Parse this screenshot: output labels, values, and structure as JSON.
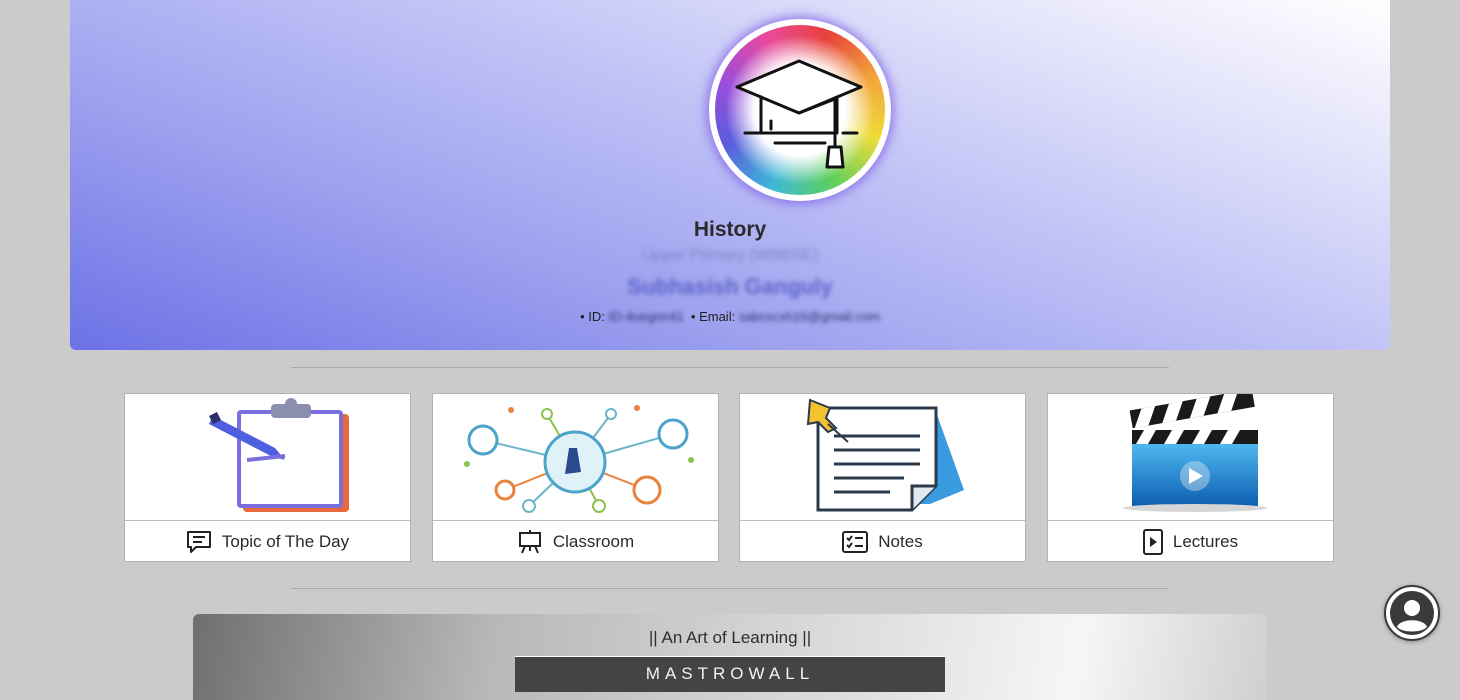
{
  "profile": {
    "course_title": "History",
    "course_subtitle": "Upper Primary (WBBSE)",
    "teacher_name": "Subhasish Ganguly",
    "id_label": "• ID:",
    "id_value": "ID-4uegnn41",
    "email_label": "• Email:",
    "email_value": "sabcxcxh16@gmail.com",
    "avatar_icon": "graduation-cap-icon"
  },
  "cards": [
    {
      "label": "Topic of The Day",
      "icon": "chat-bubble-icon",
      "art": "clipboard-pen-illustration"
    },
    {
      "label": "Classroom",
      "icon": "easel-icon",
      "art": "network-touch-illustration"
    },
    {
      "label": "Notes",
      "icon": "checklist-icon",
      "art": "pinned-notes-illustration"
    },
    {
      "label": "Lectures",
      "icon": "play-file-icon",
      "art": "clapperboard-illustration"
    }
  ],
  "footer": {
    "tagline": "|| An Art of Learning ||",
    "brand": "MASTROWALL"
  },
  "floating": {
    "icon": "user-account-icon"
  },
  "colors": {
    "page_bg": "#cbcbcb",
    "hero_gradient_dark": "#6c72e6",
    "hero_gradient_light": "#ffffff",
    "brand_box": "#444444"
  }
}
